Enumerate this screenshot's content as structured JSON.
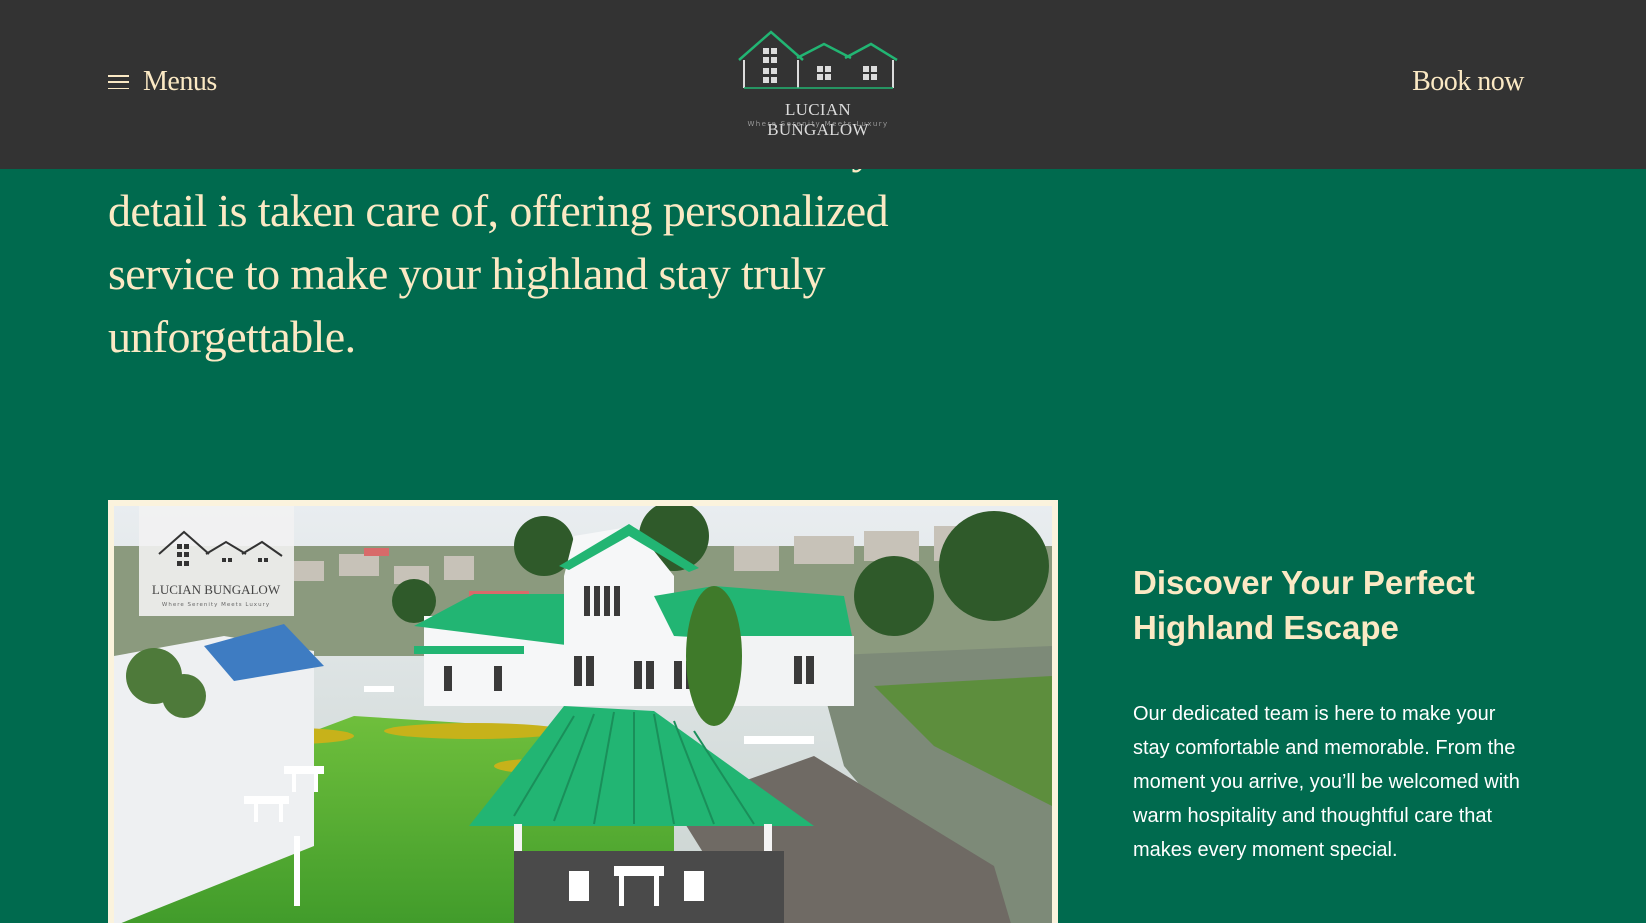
{
  "header": {
    "menu_label": "Menus",
    "logo_name": "LUCIAN BUNGALOW",
    "logo_tagline": "Where Serenity Meets Luxury",
    "book_now_label": "Book now"
  },
  "intro": {
    "text": "Our warm and attentive staff ensures every detail is taken care of, offering personalized service to make your highland stay truly unforgettable."
  },
  "photo": {
    "watermark_name": "LUCIAN BUNGALOW",
    "watermark_tagline": "Where Serenity Meets Luxury"
  },
  "discover": {
    "title": "Discover Your Perfect Highland Escape",
    "body": "Our dedicated team is here to make your stay comfortable and memorable. From the moment you arrive, you’ll be welcomed with warm hospitality and thoughtful care that makes every moment special."
  },
  "colors": {
    "background": "#006a4e",
    "header": "#333333",
    "text_cream": "#fbe9c4",
    "roof_green": "#22b573"
  }
}
